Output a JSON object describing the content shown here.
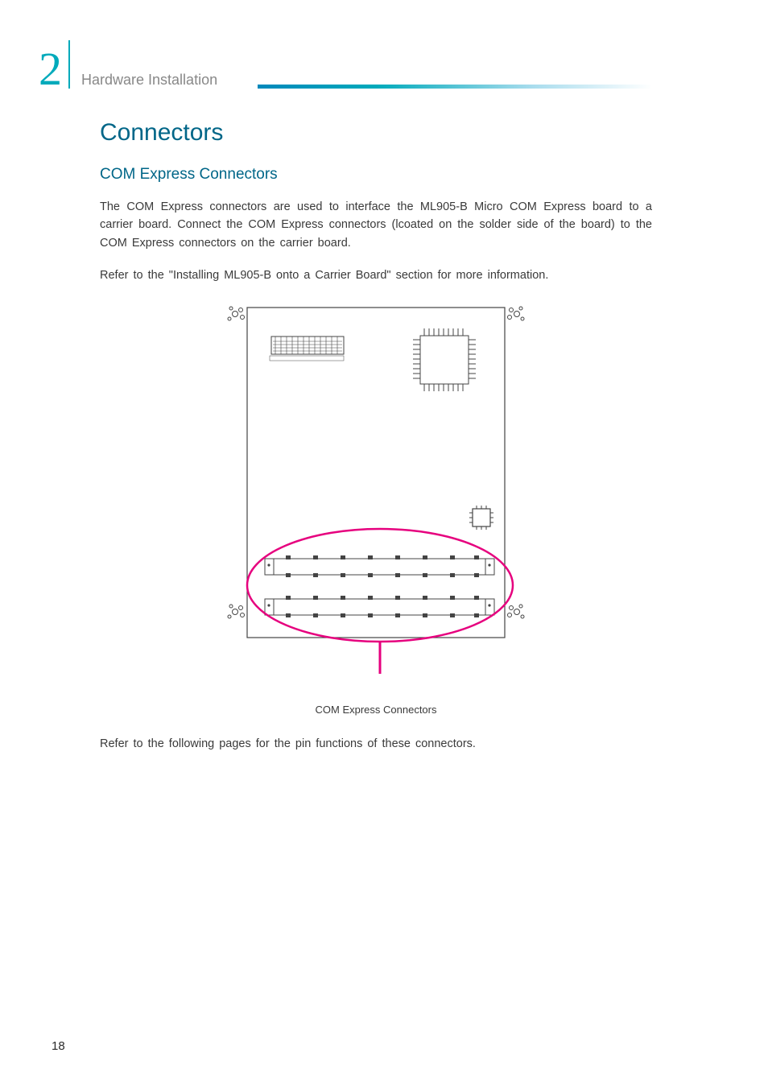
{
  "chapter": {
    "number": "2",
    "title": "Hardware Installation"
  },
  "section": {
    "h1": "Connectors",
    "h2": "COM Express Connectors",
    "para1": "The COM Express connectors are used to interface the ML905-B Micro COM Express board to a carrier board. Connect the COM Express connectors (lcoated on the solder side of the board) to the COM Express connectors on the carrier board.",
    "para2": "Refer to the \"Installing ML905-B onto a Carrier Board\" section for more information.",
    "diagram_caption": "COM Express Connectors",
    "para3": "Refer to the following pages for the pin functions of these connectors."
  },
  "page_number": "18"
}
